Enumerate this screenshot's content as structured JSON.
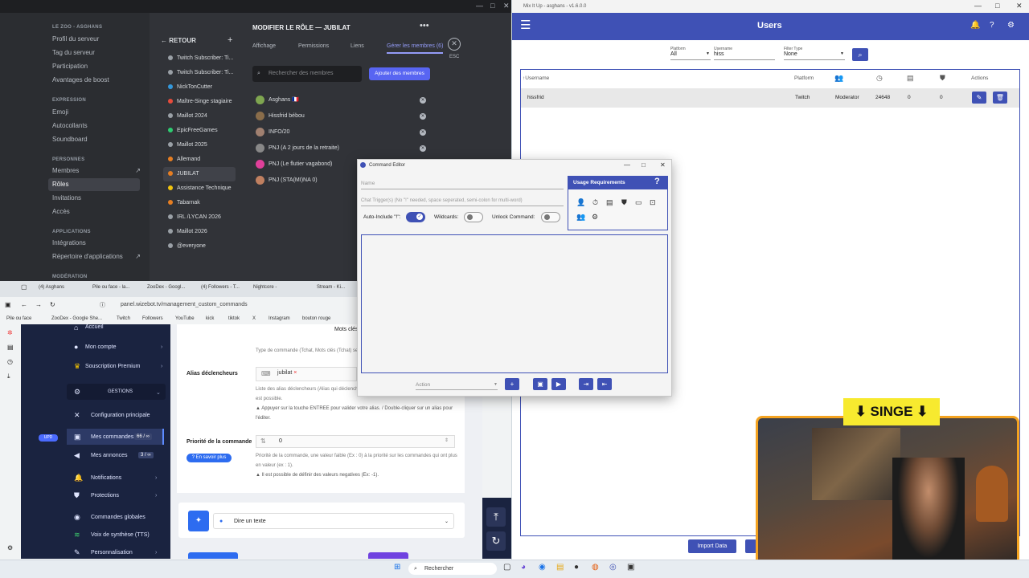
{
  "discord": {
    "server_name": "LE ZOO - ASGHANS",
    "menu": [
      {
        "label": "Profil du serveur"
      },
      {
        "label": "Tag du serveur"
      },
      {
        "label": "Participation"
      },
      {
        "label": "Avantages de boost"
      }
    ],
    "section_expression": "EXPRESSION",
    "expression_items": [
      "Emoji",
      "Autocollants",
      "Soundboard"
    ],
    "section_personnes": "PERSONNES",
    "personnes_items": [
      "Membres",
      "Rôles",
      "Invitations",
      "Accès"
    ],
    "section_applications": "APPLICATIONS",
    "applications_items": [
      "Intégrations",
      "Répertoire d'applications"
    ],
    "section_moderation": "MODÉRATION",
    "back_label": "RETOUR",
    "roles": [
      {
        "name": "Twitch Subscriber: Ti...",
        "color": "#9aa0a6"
      },
      {
        "name": "Twitch Subscriber: Ti...",
        "color": "#9aa0a6"
      },
      {
        "name": "NickTonCutter",
        "color": "#3498db"
      },
      {
        "name": "Maître-Singe stagiaire",
        "color": "#e74c3c"
      },
      {
        "name": "Maillot 2024",
        "color": "#9aa0a6"
      },
      {
        "name": "EpicFreeGames",
        "color": "#2ecc71"
      },
      {
        "name": "Maillot 2025",
        "color": "#9aa0a6"
      },
      {
        "name": "Allemand",
        "color": "#e67e22"
      },
      {
        "name": "JUBILAT",
        "color": "#e67e22"
      },
      {
        "name": "Assistance Technique",
        "color": "#f1c40f"
      },
      {
        "name": "Tabarnak",
        "color": "#e67e22"
      },
      {
        "name": "IRL /LYCAN 2026",
        "color": "#9aa0a6"
      },
      {
        "name": "Maillot 2026",
        "color": "#9aa0a6"
      },
      {
        "name": "@everyone",
        "color": "#9aa0a6"
      }
    ],
    "edit_title": "MODIFIER LE RÔLE — JUBILAT",
    "tabs": [
      "Affichage",
      "Permissions",
      "Liens",
      "Gérer les membres (6)"
    ],
    "esc_label": "ESC",
    "search_placeholder": "Rechercher des membres",
    "add_members_label": "Ajouter des membres",
    "members": [
      {
        "name": "Asghans 🇫🇷",
        "color": "#7fa650"
      },
      {
        "name": "Hissfrid bébou",
        "color": "#8a6d4a"
      },
      {
        "name": "INFO/20",
        "color": "#a08070"
      },
      {
        "name": "PNJ (A 2 jours de la retraite)",
        "color": "#888888"
      },
      {
        "name": "PNJ (Le flutier vagabond)",
        "color": "#e0409a"
      },
      {
        "name": "PNJ (STA(MI)NA 0)",
        "color": "#c08060"
      }
    ]
  },
  "mixitup": {
    "window_title": "Mix It Up - asghans - v1.6.0.0",
    "page_title": "Users",
    "filters": {
      "platform_label": "Platform",
      "platform_value": "All",
      "username_label": "Username",
      "username_value": "hiss",
      "filter_type_label": "Filter Type",
      "filter_type_value": "None"
    },
    "columns": [
      "Username",
      "Platform",
      "Actions"
    ],
    "row": {
      "username": "hissfrid",
      "platform": "Twitch",
      "role": "Moderator",
      "minutes": "24648",
      "currency": "0",
      "rank": "0"
    },
    "import_label": "Import Data"
  },
  "command_editor": {
    "title": "Command Editor",
    "name_placeholder": "Name",
    "trigger_placeholder": "Chat Trigger(s) (No \"!\" needed, space seperated, semi-colon for multi-word)",
    "auto_include_label": "Auto-Include \"!\":",
    "auto_include_on": true,
    "wildcards_label": "Wildcards:",
    "wildcards_on": false,
    "unlock_label": "Unlock Command:",
    "unlock_on": false,
    "usage_title": "Usage Requirements",
    "usage_help": "?",
    "action_placeholder": "Action"
  },
  "browser": {
    "tabs": [
      "(4) Asghans",
      "Pile ou face - la...",
      "ZooDex - Googl...",
      "(4) Followers - T...",
      "Nightcore - ",
      "Stream - Ki..."
    ],
    "url": "panel.wizebot.tv/management_custom_commands",
    "bookmarks": [
      "Pile ou face",
      "ZooDex - Google She...",
      "Twitch",
      "Followers",
      "YouTube",
      "kick",
      "tiktok",
      "X",
      "Instagram",
      "bouton rouge"
    ]
  },
  "wizebot": {
    "nav": [
      {
        "label": "Accueil",
        "icon": "home"
      },
      {
        "label": "Mon compte",
        "icon": "user"
      },
      {
        "label": "Souscription Premium",
        "icon": "crown"
      },
      {
        "label": "GESTIONS",
        "icon": "gear"
      },
      {
        "label": "Configuration principale",
        "icon": "tools"
      },
      {
        "label": "Mes commandes",
        "icon": "chat"
      },
      {
        "label": "Mes annonces",
        "icon": "megaphone"
      },
      {
        "label": "Notifications",
        "icon": "bell"
      },
      {
        "label": "Protections",
        "icon": "shield"
      },
      {
        "label": "Commandes globales",
        "icon": "globe"
      },
      {
        "label": "Voix de synthèse (TTS)",
        "icon": "wave"
      },
      {
        "label": "Personnalisation",
        "icon": "brush"
      }
    ],
    "commands_badge": "66 / ∞",
    "annonces_badge": "3 / ∞",
    "new_badge": "UPD",
    "keywords_label": "Mots clés",
    "command_type_help": "Type de commande (Tchat, Mots clés (Tchat) se",
    "alias_title": "Alias déclencheurs",
    "alias_chip": "jubilat",
    "alias_help1": "Liste des alias déclencheurs (Alias qui déclench",
    "alias_help2": "est possible.",
    "alias_help3": "Appuyer sur la touche ENTREE pour valider votre alias. / Double-cliquer sur un alias pour",
    "alias_help4": "l'éditer.",
    "priority_title": "Priorité de la commande",
    "priority_value": "0",
    "learn_more": "En savoir plus",
    "priority_help1": "Priorité de la commande, une valeur faible (Ex : 0) à la priorité sur les commandes qui ont plus",
    "priority_help2": "en valeur (ex : 1).",
    "priority_help3": "Il est possible de définir des valeurs negatives (Ex: -1).",
    "action_select": "Dire un texte"
  },
  "stream": {
    "overlay_text": "SINGE"
  },
  "taskbar": {
    "search_label": "Rechercher"
  }
}
